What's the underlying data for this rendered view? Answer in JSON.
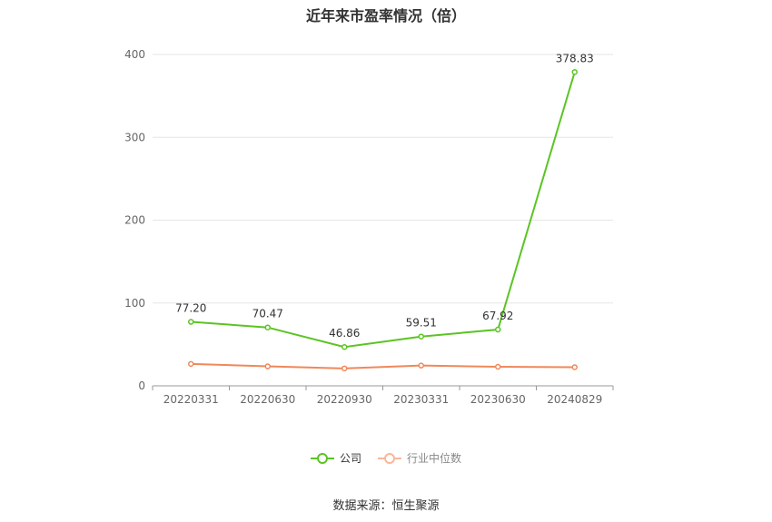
{
  "chart_data": {
    "type": "line",
    "title": "近年来市盈率情况（倍）",
    "categories": [
      "20220331",
      "20220630",
      "20220930",
      "20230331",
      "20230630",
      "20240829"
    ],
    "ylim": [
      0,
      400
    ],
    "yticks": [
      0,
      100,
      200,
      300,
      400
    ],
    "grid": true,
    "legend_position": "bottom-center",
    "series": [
      {
        "name": "公司",
        "values": [
          77.2,
          70.47,
          46.86,
          59.51,
          67.92,
          378.83
        ],
        "labels": [
          "77.20",
          "70.47",
          "46.86",
          "59.51",
          "67.92",
          "378.83"
        ],
        "color": "#5bc423"
      },
      {
        "name": "行业中位数",
        "values": [
          26.5,
          23.5,
          21.0,
          24.5,
          23.0,
          22.5
        ],
        "color": "#f0885a"
      }
    ]
  },
  "source": "数据来源：恒生聚源"
}
